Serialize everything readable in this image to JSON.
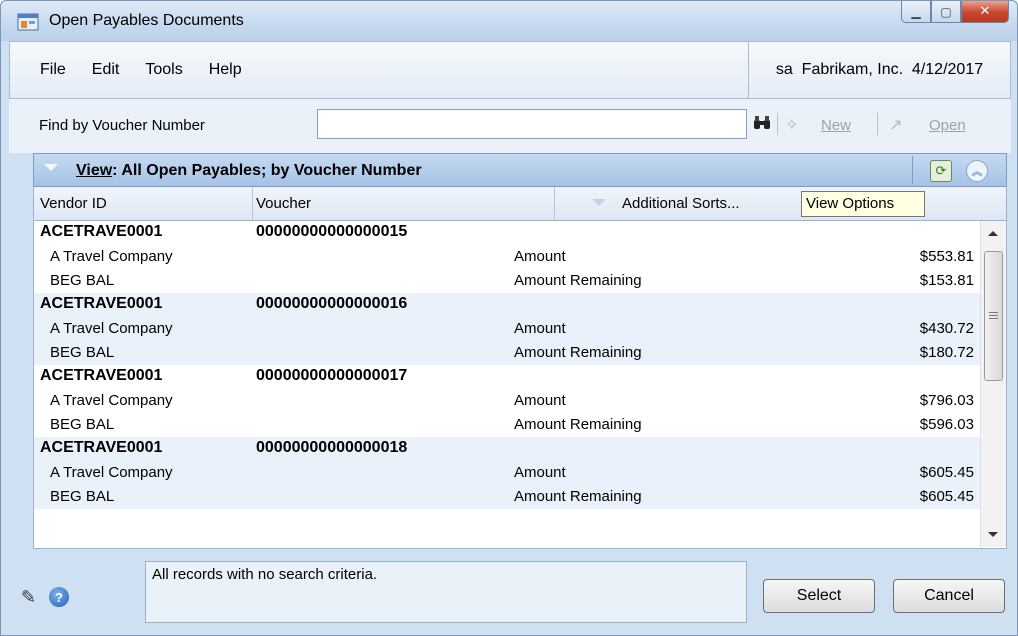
{
  "window": {
    "title": "Open Payables Documents"
  },
  "menu": {
    "items": [
      "File",
      "Edit",
      "Tools",
      "Help"
    ],
    "context": "sa  Fabrikam, Inc.  4/12/2017"
  },
  "find": {
    "label": "Find by Voucher Number",
    "value": "",
    "new_label": "New",
    "open_label": "Open"
  },
  "view": {
    "prefix": "View",
    "rest": ": All Open Payables; by Voucher Number"
  },
  "columns": {
    "vendor_id": "Vendor ID",
    "voucher": "Voucher",
    "additional_sorts": "Additional Sorts..."
  },
  "tooltip": "View Options",
  "records": [
    {
      "vendor_id": "ACETRAVE0001",
      "voucher": "00000000000000015",
      "vendor_name": "A Travel Company",
      "doc_desc": "BEG BAL",
      "amount_label": "Amount",
      "amount": "$553.81",
      "remaining_label": "Amount Remaining",
      "remaining": "$153.81"
    },
    {
      "vendor_id": "ACETRAVE0001",
      "voucher": "00000000000000016",
      "vendor_name": "A Travel Company",
      "doc_desc": "BEG BAL",
      "amount_label": "Amount",
      "amount": "$430.72",
      "remaining_label": "Amount Remaining",
      "remaining": "$180.72"
    },
    {
      "vendor_id": "ACETRAVE0001",
      "voucher": "00000000000000017",
      "vendor_name": "A Travel Company",
      "doc_desc": "BEG BAL",
      "amount_label": "Amount",
      "amount": "$796.03",
      "remaining_label": "Amount Remaining",
      "remaining": "$596.03"
    },
    {
      "vendor_id": "ACETRAVE0001",
      "voucher": "00000000000000018",
      "vendor_name": "A Travel Company",
      "doc_desc": "BEG BAL",
      "amount_label": "Amount",
      "amount": "$605.45",
      "remaining_label": "Amount Remaining",
      "remaining": "$605.45"
    }
  ],
  "status": "All records with no search criteria.",
  "buttons": {
    "select": "Select",
    "cancel": "Cancel"
  },
  "icons": {
    "app": "app-window-icon",
    "find": "binoculars-icon",
    "new": "new-document-icon",
    "open": "open-folder-icon",
    "refresh": "refresh-icon",
    "collapse": "double-chevron-up-icon",
    "note": "note-icon",
    "help": "help-icon"
  }
}
